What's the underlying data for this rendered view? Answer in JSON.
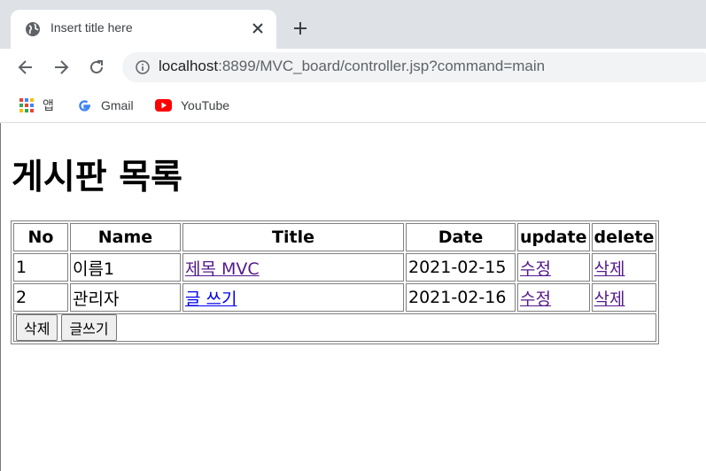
{
  "browser": {
    "tab_title": "Insert title here",
    "url_host": "localhost",
    "url_rest": ":8899/MVC_board/controller.jsp?command=main",
    "bookmarks": [
      {
        "label": "앱",
        "icon": "apps-grid-icon"
      },
      {
        "label": "Gmail",
        "icon": "google-g-icon"
      },
      {
        "label": "YouTube",
        "icon": "youtube-icon"
      }
    ]
  },
  "page": {
    "heading": "게시판 목록",
    "table": {
      "headers": [
        "No",
        "Name",
        "Title",
        "Date",
        "update",
        "delete"
      ],
      "rows": [
        {
          "no": "1",
          "name": "이름1",
          "title": "제목 MVC",
          "date": "2021-02-15",
          "update": "수정",
          "delete": "삭제"
        },
        {
          "no": "2",
          "name": "관리자",
          "title": "글 쓰기",
          "date": "2021-02-16",
          "update": "수정",
          "delete": "삭제"
        }
      ]
    },
    "buttons": {
      "delete": "삭제",
      "write": "글쓰기"
    }
  },
  "colors": {
    "visited_link": "#551a8b",
    "unvisited_link": "#0000ee",
    "tabstrip": "#dee1e6"
  }
}
